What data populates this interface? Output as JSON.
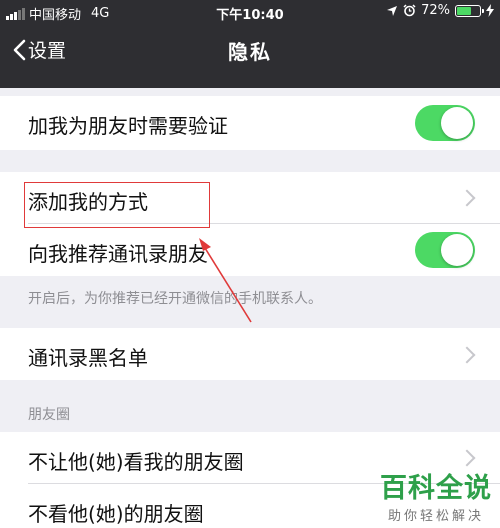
{
  "status_bar": {
    "carrier": "中国移动",
    "network": "4G",
    "time": "下午10:40",
    "battery": "72%",
    "battery_level": 0.72
  },
  "nav": {
    "back_label": "设置",
    "title": "隐私"
  },
  "settings": {
    "verify_friend": {
      "label": "加我为朋友时需要验证",
      "on": true
    },
    "add_methods": {
      "label": "添加我的方式"
    },
    "recommend_contacts": {
      "label": "向我推荐通讯录朋友",
      "on": true
    },
    "recommend_note": "开启后，为你推荐已经开通微信的手机联系人。",
    "blacklist": {
      "label": "通讯录黑名单"
    },
    "moments_header": "朋友圈",
    "hide_my_moments": {
      "label": "不让他(她)看我的朋友圈"
    },
    "hide_their_moments": {
      "label": "不看他(她)的朋友圈"
    }
  },
  "watermark": {
    "title": "百科全说",
    "subtitle": "助你轻松解决"
  },
  "colors": {
    "nav_bg": "#2e2e32",
    "toggle_on": "#4cd964",
    "annotation": "#e03a3a",
    "watermark": "#2ea04a"
  }
}
